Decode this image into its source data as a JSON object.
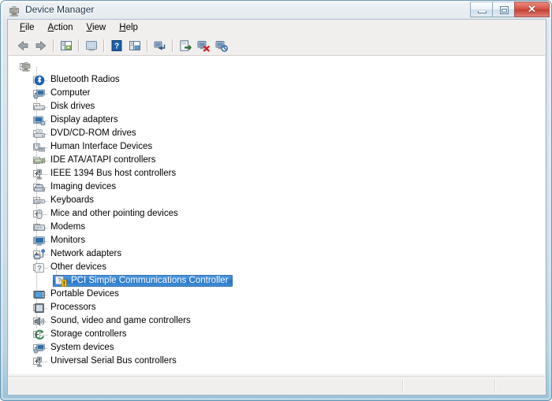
{
  "window": {
    "title": "Device Manager",
    "icon": "device-manager-icon",
    "controls": {
      "minimize": "Minimize",
      "maximize": "Maximize",
      "close": "Close",
      "close_glyph": "✕"
    }
  },
  "menubar": {
    "items": [
      {
        "name": "file",
        "accel": "F",
        "rest": "ile"
      },
      {
        "name": "action",
        "accel": "A",
        "rest": "ction"
      },
      {
        "name": "view",
        "accel": "V",
        "rest": "iew"
      },
      {
        "name": "help",
        "accel": "H",
        "rest": "elp"
      }
    ]
  },
  "toolbar": {
    "buttons": [
      {
        "name": "back-button",
        "icon": "left-arrow-icon",
        "title": "Back"
      },
      {
        "name": "forward-button",
        "icon": "right-arrow-icon",
        "title": "Forward"
      },
      {
        "name": "show-hide-tree-button",
        "icon": "console-tree-icon",
        "title": "Show/hide console tree"
      },
      {
        "name": "properties-button",
        "icon": "properties-icon",
        "title": "Properties"
      },
      {
        "name": "help-button",
        "icon": "help-question-icon",
        "title": "Help"
      },
      {
        "name": "view-button",
        "icon": "view-pane-icon",
        "title": "View"
      },
      {
        "name": "scan-hardware-button",
        "icon": "scan-hardware-icon",
        "title": "Scan for hardware changes"
      },
      {
        "name": "update-driver-button",
        "icon": "update-driver-icon",
        "title": "Update Driver Software"
      },
      {
        "name": "uninstall-button",
        "icon": "uninstall-device-icon",
        "title": "Uninstall"
      },
      {
        "name": "disable-button",
        "icon": "disable-device-icon",
        "title": "Disable"
      }
    ]
  },
  "tree": {
    "root": {
      "label": "",
      "icon": "computer-root-icon",
      "expanded": true
    },
    "nodes": [
      {
        "label": "Bluetooth Radios",
        "icon": "bluetooth-icon"
      },
      {
        "label": "Computer",
        "icon": "computer-icon"
      },
      {
        "label": "Disk drives",
        "icon": "disk-drive-icon"
      },
      {
        "label": "Display adapters",
        "icon": "display-adapter-icon"
      },
      {
        "label": "DVD/CD-ROM drives",
        "icon": "dvd-drive-icon"
      },
      {
        "label": "Human Interface Devices",
        "icon": "hid-icon"
      },
      {
        "label": "IDE ATA/ATAPI controllers",
        "icon": "ide-controller-icon"
      },
      {
        "label": "IEEE 1394 Bus host controllers",
        "icon": "ieee1394-icon"
      },
      {
        "label": "Imaging devices",
        "icon": "imaging-device-icon"
      },
      {
        "label": "Keyboards",
        "icon": "keyboard-icon"
      },
      {
        "label": "Mice and other pointing devices",
        "icon": "mouse-icon"
      },
      {
        "label": "Modems",
        "icon": "modem-icon"
      },
      {
        "label": "Monitors",
        "icon": "monitor-icon"
      },
      {
        "label": "Network adapters",
        "icon": "network-adapter-icon"
      },
      {
        "label": "Other devices",
        "icon": "other-devices-icon",
        "expanded": true,
        "children": [
          {
            "label": "PCI Simple Communications Controller",
            "icon": "unknown-device-warning-icon",
            "selected": true
          }
        ]
      },
      {
        "label": "Portable Devices",
        "icon": "portable-device-icon"
      },
      {
        "label": "Processors",
        "icon": "processor-icon"
      },
      {
        "label": "Sound, video and game controllers",
        "icon": "sound-controller-icon"
      },
      {
        "label": "Storage controllers",
        "icon": "storage-controller-icon"
      },
      {
        "label": "System devices",
        "icon": "system-device-icon"
      },
      {
        "label": "Universal Serial Bus controllers",
        "icon": "usb-controller-icon"
      }
    ]
  },
  "statusbar": {
    "text": ""
  },
  "colors": {
    "selection": "#2f7dcd",
    "warning_badge": "#f5c518",
    "close_button": "#d9564a",
    "frame": "#9cc3d8"
  }
}
